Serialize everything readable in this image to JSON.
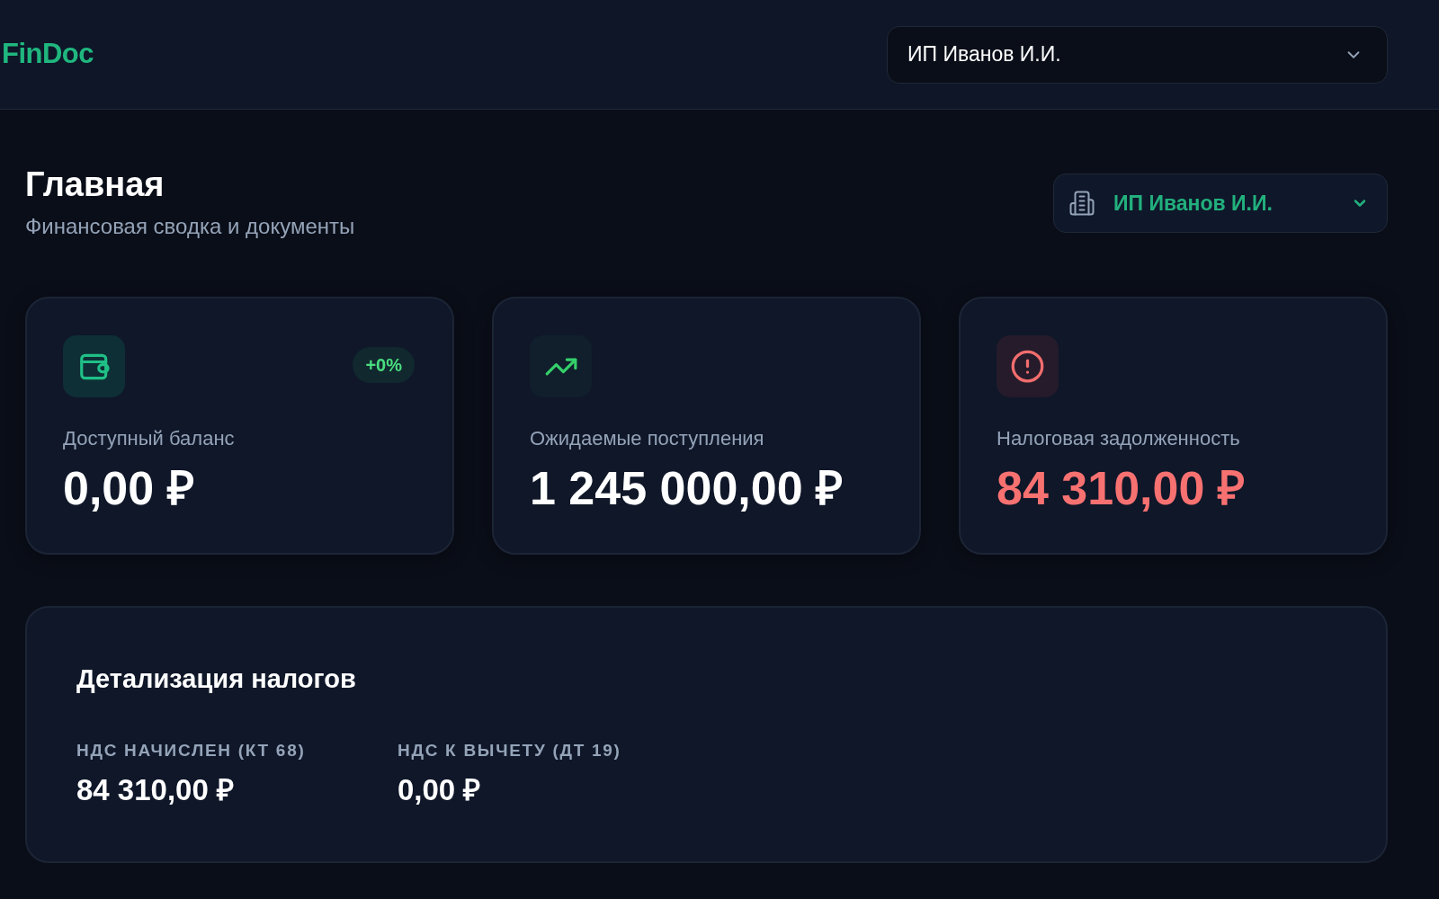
{
  "header": {
    "logo": "FinDoc",
    "organization_select": {
      "value": "ИП Иванов И.И."
    }
  },
  "page_header": {
    "title": "Главная",
    "subtitle": "Финансовая сводка и документы",
    "organization_switcher": {
      "value": "ИП Иванов И.И."
    }
  },
  "summary_cards": [
    {
      "kind": "balance",
      "label": "Доступный баланс",
      "value": "0,00 ₽",
      "badge": "+0%"
    },
    {
      "kind": "income",
      "label": "Ожидаемые поступления",
      "value": "1 245 000,00 ₽"
    },
    {
      "kind": "debt",
      "label": "Налоговая задолженность",
      "value": "84 310,00 ₽"
    }
  ],
  "tax_details": {
    "title": "Детализация налогов",
    "items": [
      {
        "label": "НДС НАЧИСЛЕН (КТ 68)",
        "value": "84 310,00 ₽"
      },
      {
        "label": "НДС К ВЫЧЕТУ (ДТ 19)",
        "value": "0,00 ₽"
      }
    ]
  }
}
